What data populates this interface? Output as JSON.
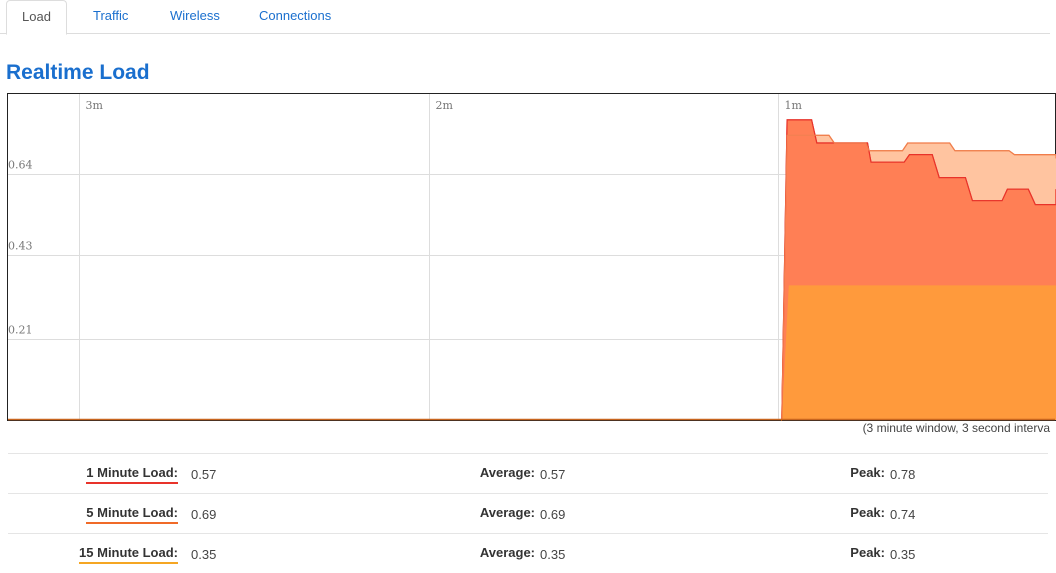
{
  "tabs": [
    {
      "label": "Load",
      "active": true
    },
    {
      "label": "Traffic",
      "active": false
    },
    {
      "label": "Wireless",
      "active": false
    },
    {
      "label": "Connections",
      "active": false
    }
  ],
  "page_title": "Realtime Load",
  "chart_note": "(3 minute window, 3 second interva",
  "colors": {
    "accent": "#1a6fce",
    "load_1min": "#e8332a",
    "load_5min": "#f06a28",
    "load_15min": "#f5a623"
  },
  "chart_data": {
    "type": "area",
    "x_ticks": [
      "3m",
      "2m",
      "1m"
    ],
    "y_ticks": [
      "0.64",
      "0.43",
      "0.21"
    ],
    "ylim": [
      0,
      0.85
    ],
    "x_range_seconds": [
      -180,
      0
    ],
    "series": [
      {
        "name": "1 Minute Load",
        "color": "#e8332a",
        "fill": "#f08a8a",
        "points": [
          [
            -59.4,
            0
          ],
          [
            -58.5,
            0.78
          ],
          [
            -54.3,
            0.78
          ],
          [
            -53.4,
            0.72
          ],
          [
            -44.7,
            0.72
          ],
          [
            -44.1,
            0.67
          ],
          [
            -38.4,
            0.67
          ],
          [
            -37.5,
            0.69
          ],
          [
            -33.6,
            0.69
          ],
          [
            -32.4,
            0.63
          ],
          [
            -27.9,
            0.63
          ],
          [
            -26.7,
            0.57
          ],
          [
            -21.6,
            0.57
          ],
          [
            -20.7,
            0.6
          ],
          [
            -17.1,
            0.6
          ],
          [
            -15.9,
            0.56
          ],
          [
            -11.1,
            0.56
          ],
          [
            -10.2,
            0.6
          ],
          [
            -5.4,
            0.6
          ],
          [
            -4.2,
            0.57
          ],
          [
            0,
            0.57
          ]
        ]
      },
      {
        "name": "5 Minute Load",
        "color": "#f06a28",
        "fill": "#ffc4a0",
        "points": [
          [
            -59.4,
            0
          ],
          [
            -58.5,
            0.74
          ],
          [
            -51.3,
            0.74
          ],
          [
            -50.4,
            0.72
          ],
          [
            -45.0,
            0.72
          ],
          [
            -44.4,
            0.7
          ],
          [
            -38.7,
            0.7
          ],
          [
            -37.8,
            0.72
          ],
          [
            -30.6,
            0.72
          ],
          [
            -29.7,
            0.7
          ],
          [
            -20.4,
            0.7
          ],
          [
            -19.5,
            0.69
          ],
          [
            -4.5,
            0.69
          ],
          [
            -3.6,
            0.68
          ],
          [
            0,
            0.68
          ]
        ]
      },
      {
        "name": "15 Minute Load",
        "color": "#f5a623",
        "fill": "#ff9a3c",
        "points": [
          [
            -59.4,
            0
          ],
          [
            -58.2,
            0.35
          ],
          [
            0,
            0.35
          ]
        ]
      }
    ]
  },
  "stats": [
    {
      "label": "1 Minute Load:",
      "value": "0.57",
      "avg_label": "Average:",
      "avg": "0.57",
      "peak_label": "Peak:",
      "peak": "0.78",
      "underline": "#e8332a"
    },
    {
      "label": "5 Minute Load:",
      "value": "0.69",
      "avg_label": "Average:",
      "avg": "0.69",
      "peak_label": "Peak:",
      "peak": "0.74",
      "underline": "#f06a28"
    },
    {
      "label": "15 Minute Load:",
      "value": "0.35",
      "avg_label": "Average:",
      "avg": "0.35",
      "peak_label": "Peak:",
      "peak": "0.35",
      "underline": "#f5a623"
    }
  ]
}
